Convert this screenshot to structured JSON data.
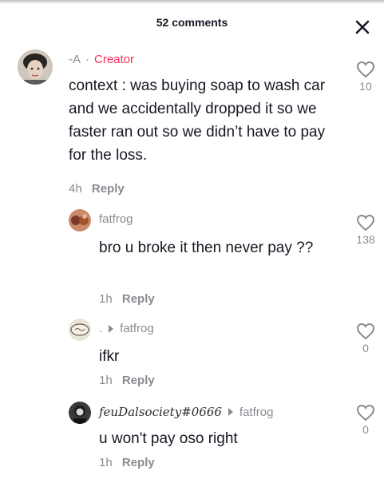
{
  "header": {
    "title": "52 comments",
    "close_icon": "close-icon"
  },
  "colors": {
    "creator": "#fe2c55",
    "meta": "#8a8b91",
    "text": "#161823"
  },
  "comments": [
    {
      "author": "-A",
      "badge": "Creator",
      "separator": "·",
      "text": "context : was buying soap to wash car and we accidentally dropped it so we faster ran out so we didn’t have to pay for the loss.",
      "time": "4h",
      "reply_label": "Reply",
      "likes": "10"
    },
    {
      "author": "fatfrog",
      "text": "bro u broke it then never pay ??",
      "time": "1h",
      "reply_label": "Reply",
      "likes": "138"
    },
    {
      "author": ".",
      "reply_to": "fatfrog",
      "text": "ifkr",
      "time": "1h",
      "reply_label": "Reply",
      "likes": "0"
    },
    {
      "author": "feuDalsociety#0666",
      "reply_to": "fatfrog",
      "text": "u won't pay oso right",
      "time": "1h",
      "reply_label": "Reply",
      "likes": "0"
    }
  ]
}
